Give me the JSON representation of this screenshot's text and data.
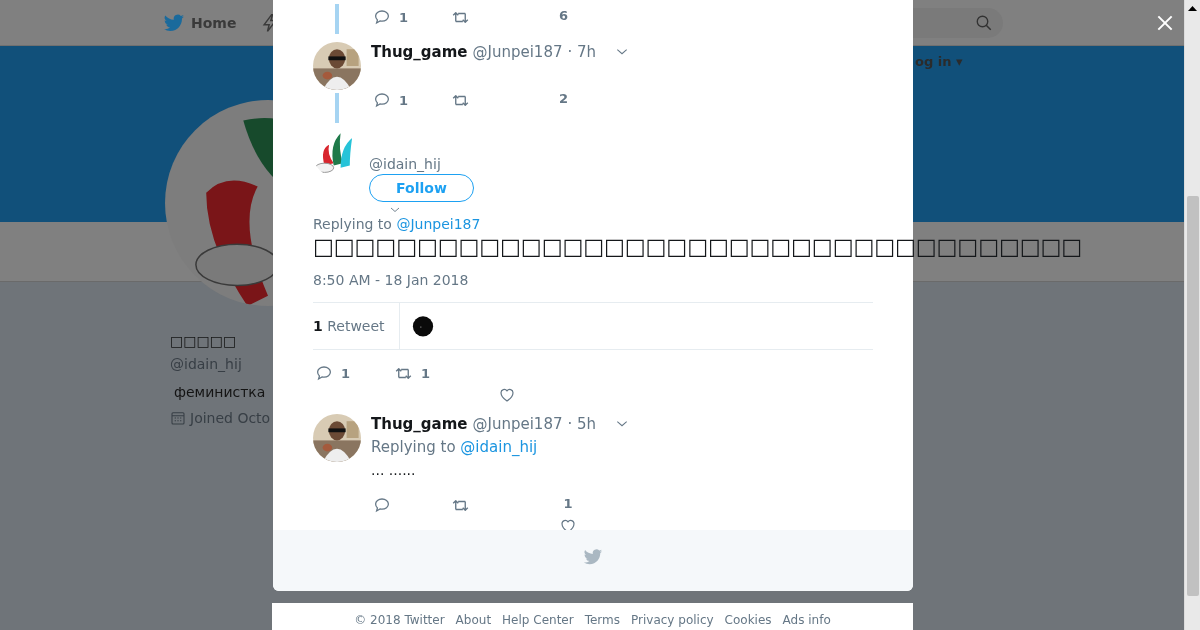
{
  "top_nav": {
    "home": "Home",
    "login_menu": "og in ▾"
  },
  "profile": {
    "name": "□□□□□",
    "handle": "@idain_hij",
    "bio": "феминистка",
    "joined": "Joined Octo"
  },
  "modal": {
    "thread": [
      {
        "kind": "thread",
        "actions": {
          "replies": "1",
          "likes": "6"
        }
      },
      {
        "kind": "thread",
        "name": "Thug_game",
        "handle": "@Junpei187",
        "time": "· 7h",
        "actions": {
          "replies": "1",
          "likes": "2"
        }
      }
    ],
    "main_tweet": {
      "handle": "@idain_hij",
      "follow": "Follow",
      "replying_prefix": "Replying to",
      "replying_to": "@Junpei187",
      "text": "□□□□□□□□□□□□□□□□□□□□□□□□□□□□□□□□□□□□□",
      "timestamp": "8:50 AM - 18 Jan 2018",
      "retweet_stat": "**1** Retweet",
      "actions": {
        "replies": "1",
        "retweets": "1"
      }
    },
    "replies": [
      {
        "kind": "reply",
        "name": "Thug_game",
        "handle": "@Junpei187",
        "time": "· 5h",
        "replying_prefix": "Replying to",
        "replying_to": "@idain_hij",
        "text": "... ......",
        "actions": {
          "likes": "1"
        }
      }
    ]
  },
  "footer_links": [
    "© 2018 Twitter",
    "About",
    "Help Center",
    "Terms",
    "Privacy policy",
    "Cookies",
    "Ads info"
  ]
}
